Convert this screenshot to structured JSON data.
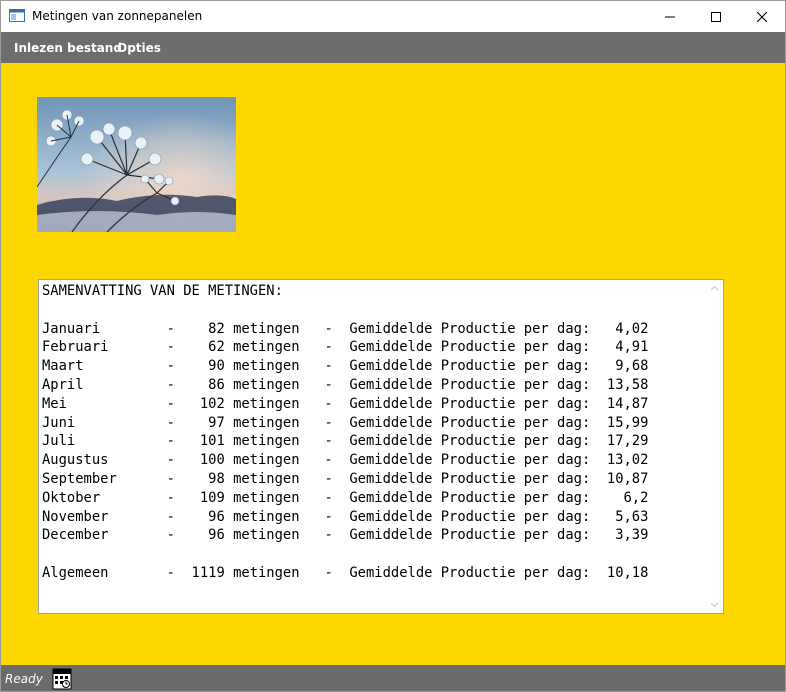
{
  "window": {
    "title": "Metingen van zonnepanelen",
    "icons": {
      "app": "window-app-icon",
      "minimize": "minimize-icon",
      "maximize": "maximize-icon",
      "close": "close-icon"
    }
  },
  "menu": {
    "items": [
      {
        "label": "Inlezen bestand"
      },
      {
        "label": "Opties"
      }
    ]
  },
  "image": {
    "subject": "frosted-flower-photo"
  },
  "summary": {
    "heading": "SAMENVATTING VAN DE METINGEN:",
    "unit_label": "metingen",
    "metric_label": "Gemiddelde Productie per dag:",
    "rows": [
      {
        "month": "Januari",
        "count": "82",
        "avg": "4,02"
      },
      {
        "month": "Februari",
        "count": "62",
        "avg": "4,91"
      },
      {
        "month": "Maart",
        "count": "90",
        "avg": "9,68"
      },
      {
        "month": "April",
        "count": "86",
        "avg": "13,58"
      },
      {
        "month": "Mei",
        "count": "102",
        "avg": "14,87"
      },
      {
        "month": "Juni",
        "count": "97",
        "avg": "15,99"
      },
      {
        "month": "Juli",
        "count": "101",
        "avg": "17,29"
      },
      {
        "month": "Augustus",
        "count": "100",
        "avg": "13,02"
      },
      {
        "month": "September",
        "count": "98",
        "avg": "10,87"
      },
      {
        "month": "Oktober",
        "count": "109",
        "avg": "6,2"
      },
      {
        "month": "November",
        "count": "96",
        "avg": "5,63"
      },
      {
        "month": "December",
        "count": "96",
        "avg": "3,39"
      }
    ],
    "total": {
      "month": "Algemeen",
      "count": "1119",
      "avg": "10,18"
    }
  },
  "status": {
    "text": "Ready",
    "icon": "keyboard-calendar-icon"
  },
  "colors": {
    "background": "#ffd700",
    "menubar": "#6d6d6d",
    "statusbar": "#6b6b6b"
  }
}
